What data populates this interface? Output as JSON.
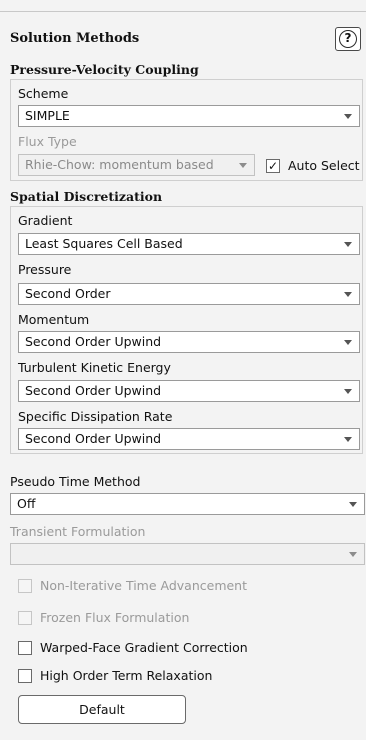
{
  "panel": {
    "title": "Solution Methods",
    "help_glyph": "?",
    "help_icon": "question-circle-icon"
  },
  "pressure_velocity": {
    "title": "Pressure-Velocity Coupling",
    "scheme_label": "Scheme",
    "scheme_value": "SIMPLE",
    "flux_type_label": "Flux Type",
    "flux_type_value": "Rhie-Chow: momentum based",
    "auto_select_label": "Auto Select",
    "auto_select_checked": true,
    "check_glyph": "✓"
  },
  "spatial": {
    "title": "Spatial Discretization",
    "gradient_label": "Gradient",
    "gradient_value": "Least Squares Cell Based",
    "pressure_label": "Pressure",
    "pressure_value": "Second Order",
    "momentum_label": "Momentum",
    "momentum_value": "Second Order Upwind",
    "tke_label": "Turbulent Kinetic Energy",
    "tke_value": "Second Order Upwind",
    "sdr_label": "Specific Dissipation Rate",
    "sdr_value": "Second Order Upwind"
  },
  "pseudo_time": {
    "label": "Pseudo Time Method",
    "value": "Off"
  },
  "transient": {
    "label": "Transient Formulation",
    "value": ""
  },
  "options": {
    "nita_label": "Non-Iterative Time Advancement",
    "frozen_flux_label": "Frozen Flux Formulation",
    "warped_face_label": "Warped-Face Gradient Correction",
    "high_order_label": "High Order Term Relaxation"
  },
  "default_button_label": "Default"
}
